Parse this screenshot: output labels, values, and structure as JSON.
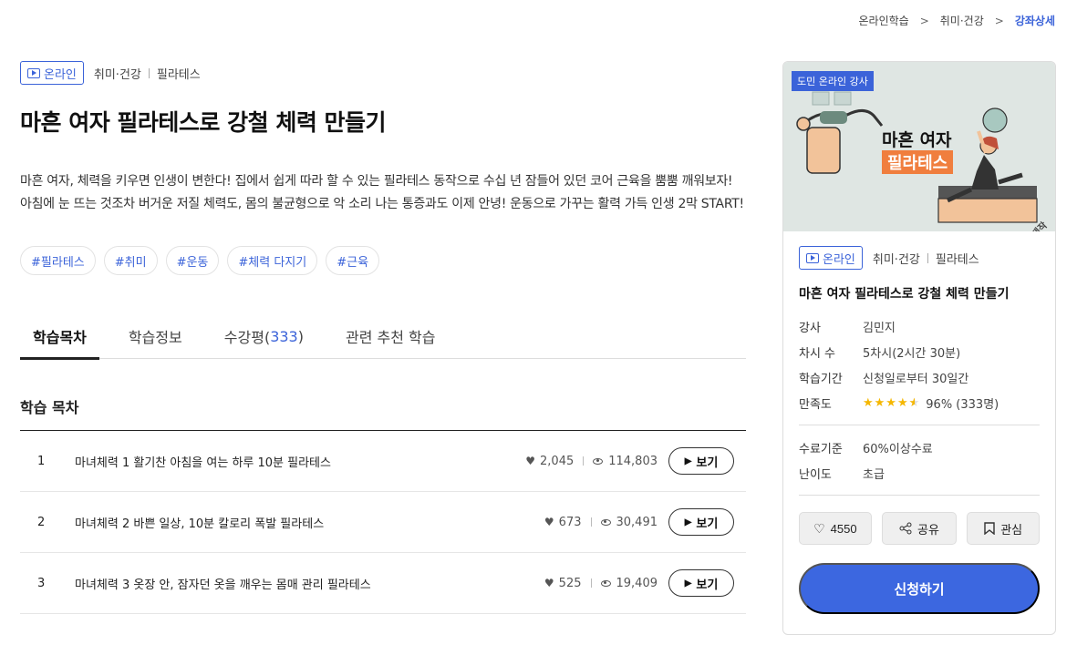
{
  "breadcrumb": [
    "온라인학습",
    "취미·건강",
    "강좌상세"
  ],
  "course": {
    "badge": "온라인",
    "category1": "취미·건강",
    "category2": "필라테스",
    "title": "마흔 여자 필라테스로 강철 체력 만들기",
    "description": "마흔 여자, 체력을 키우면 인생이 변한다! 집에서 쉽게 따라 할 수 있는 필라테스 동작으로 수십 년 잠들어 있던 코어 근육을 뿜뿜 깨워보자! 아침에 눈 뜨는 것조차 버거운 저질 체력도, 몸의 불균형으로 악 소리 나는 통증과도 이제 안녕! 운동으로 가꾸는 활력 가득 인생 2막 START!",
    "tags": [
      "#필라테스",
      "#취미",
      "#운동",
      "#체력 다지기",
      "#근육"
    ]
  },
  "tabs": [
    {
      "label": "학습목차",
      "count": ""
    },
    {
      "label": "학습정보",
      "count": ""
    },
    {
      "label": "수강평(",
      "count": "333",
      "suffix": ")"
    },
    {
      "label": "관련 추천 학습",
      "count": ""
    }
  ],
  "toc": {
    "title": "학습 목차",
    "view_label": "보기",
    "items": [
      {
        "num": "1",
        "name": "마녀체력 1 활기찬 아침을 여는 하루 10분 필라테스",
        "likes": "2,045",
        "views": "114,803"
      },
      {
        "num": "2",
        "name": "마녀체력 2 바쁜 일상, 10분 칼로리 폭발 필라테스",
        "likes": "673",
        "views": "30,491"
      },
      {
        "num": "3",
        "name": "마녀체력 3 옷장 안, 잠자던 옷을 깨우는 몸매 관리 필라테스",
        "likes": "525",
        "views": "19,409"
      }
    ]
  },
  "card": {
    "thumb_badge": "도민 온라인 강사",
    "thumb_title1": "마흔 여자",
    "thumb_title2": "필라테스",
    "thumb_logo": "GSEEK 제작",
    "badge": "온라인",
    "category1": "취미·건강",
    "category2": "필라테스",
    "title": "마흔 여자 필라테스로 강철 체력 만들기",
    "info": [
      {
        "label": "강사",
        "value": "김민지"
      },
      {
        "label": "차시 수",
        "value": "5차시(2시간 30분)"
      },
      {
        "label": "학습기간",
        "value": "신청일로부터 30일간"
      }
    ],
    "rating_label": "만족도",
    "rating_stars": 4.5,
    "rating_value": "96% (333명)",
    "info2": [
      {
        "label": "수료기준",
        "value": "60%이상수료"
      },
      {
        "label": "난이도",
        "value": "초급"
      }
    ],
    "like_count": "4550",
    "share_label": "공유",
    "bookmark_label": "관심",
    "apply_label": "신청하기"
  },
  "colors": {
    "accent": "#3b63d9",
    "apply": "#3c67e0",
    "star": "#f5b700",
    "thumb_orange": "#f07e3e"
  }
}
